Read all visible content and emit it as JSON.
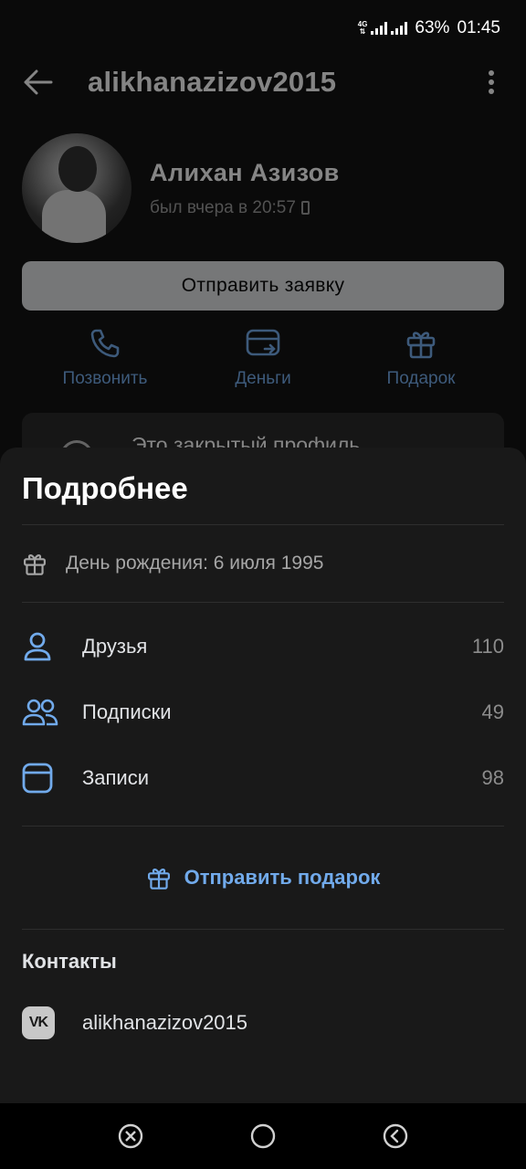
{
  "status_bar": {
    "network_type": "4G",
    "battery": "63%",
    "time": "01:45"
  },
  "header": {
    "back_icon": "arrow-left-icon",
    "title": "alikhanazizov2015",
    "more_icon": "more-vertical-icon"
  },
  "profile": {
    "name": "Алихан Азизов",
    "last_seen": "был вчера в 20:57",
    "request_button": "Отправить заявку",
    "actions": [
      {
        "label": "Позвонить",
        "icon": "phone-icon"
      },
      {
        "label": "Деньги",
        "icon": "money-icon"
      },
      {
        "label": "Подарок",
        "icon": "gift-icon"
      }
    ],
    "private_notice": "Это закрытый профиль"
  },
  "sheet": {
    "title": "Подробнее",
    "birthday": "День рождения: 6 июля 1995",
    "stats": [
      {
        "label": "Друзья",
        "count": "110",
        "icon": "user-icon"
      },
      {
        "label": "Подписки",
        "count": "49",
        "icon": "users-icon"
      },
      {
        "label": "Записи",
        "count": "98",
        "icon": "posts-icon"
      }
    ],
    "send_gift": "Отправить подарок",
    "contacts_heading": "Контакты",
    "contact": {
      "label": "alikhanazizov2015",
      "icon": "vk-icon",
      "logo_text": "VK"
    }
  },
  "colors": {
    "accent": "#71aaeb",
    "sheet_bg": "#191919",
    "page_bg": "#0a0a0a"
  }
}
